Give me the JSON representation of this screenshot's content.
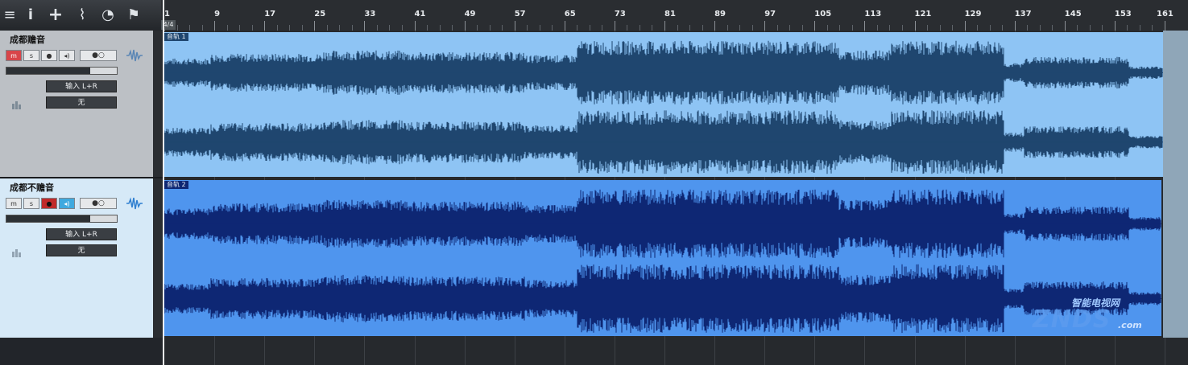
{
  "toolbar": {
    "icons": [
      "menu-icon",
      "info-icon",
      "add-icon",
      "automation-icon",
      "tempo-icon",
      "marker-icon"
    ],
    "glyphs": [
      "≡",
      "i",
      "+",
      "⌇",
      "◔",
      "⚑"
    ]
  },
  "ruler": {
    "time_signature": "4/4",
    "bars": [
      "1",
      "9",
      "17",
      "25",
      "33",
      "41",
      "49",
      "57",
      "65",
      "73",
      "81",
      "89",
      "97",
      "105",
      "113",
      "121",
      "129",
      "137",
      "145",
      "153",
      "161"
    ]
  },
  "tracks": [
    {
      "name": "成都赡音",
      "mute": "m",
      "solo": "s",
      "record": "●",
      "monitor": "◂)",
      "extra": "●○",
      "input": "输入 L+R",
      "output": "无",
      "event_label": "音轨 1",
      "colors": {
        "header": "#bcc0c5",
        "event_bg": "#8ec4f4",
        "wave": "#1f466f",
        "mute_on": "#d8454a",
        "record_on": false
      }
    },
    {
      "name": "成都不赡音",
      "mute": "m",
      "solo": "s",
      "record": "●",
      "monitor": "◂)",
      "extra": "●○",
      "input": "输入 L+R",
      "output": "无",
      "event_label": "音轨 2",
      "colors": {
        "header": "#d6e9f7",
        "event_bg": "#4f95ee",
        "wave": "#0e2774",
        "mute_on": false,
        "record_on": "#c02a2a",
        "monitor_on": "#3fa9df"
      }
    }
  ],
  "watermark": {
    "top": "智能电视网",
    "main": "ZNDS",
    "suffix": ".com"
  }
}
